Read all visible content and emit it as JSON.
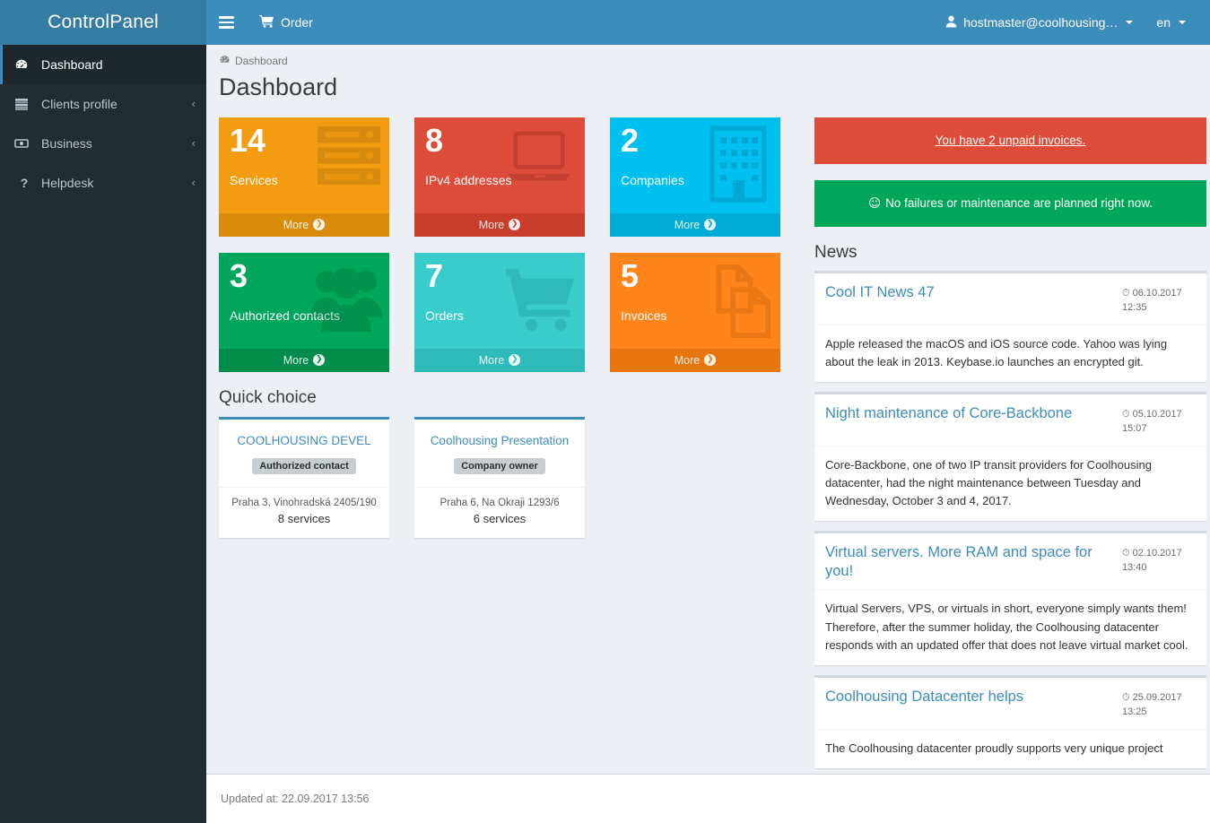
{
  "brand": {
    "name": "ControlPanel"
  },
  "header": {
    "menu_toggle": "menu-toggle",
    "order_label": "Order",
    "user_label": "hostmaster@coolhousing…",
    "lang_label": "en"
  },
  "sidebar": {
    "items": [
      {
        "label": "Dashboard",
        "icon": "dashboard-icon",
        "active": true,
        "caret": ""
      },
      {
        "label": "Clients profile",
        "icon": "server-icon",
        "active": false,
        "caret": "‹"
      },
      {
        "label": "Business",
        "icon": "money-icon",
        "active": false,
        "caret": "‹"
      },
      {
        "label": "Helpdesk",
        "icon": "question-icon",
        "active": false,
        "caret": "‹"
      }
    ]
  },
  "breadcrumb": {
    "icon": "dashboard-icon",
    "label": "Dashboard"
  },
  "page": {
    "title": "Dashboard"
  },
  "tiles": [
    {
      "number": "14",
      "caption": "Services",
      "more": "More",
      "color": "#f39c12",
      "footer_color": "#db8b0b",
      "icon": "server-rack-icon"
    },
    {
      "number": "8",
      "caption": "IPv4 addresses",
      "more": "More",
      "color": "#dd4b39",
      "footer_color": "#c93d2b",
      "icon": "laptop-icon"
    },
    {
      "number": "2",
      "caption": "Companies",
      "more": "More",
      "color": "#00c0ef",
      "footer_color": "#00acd6",
      "icon": "building-icon"
    },
    {
      "number": "3",
      "caption": "Authorized contacts",
      "more": "More",
      "color": "#00a65a",
      "footer_color": "#008d4c",
      "icon": "users-icon"
    },
    {
      "number": "7",
      "caption": "Orders",
      "more": "More",
      "color": "#39cccc",
      "footer_color": "#30bbbb",
      "icon": "cart-icon"
    },
    {
      "number": "5",
      "caption": "Invoices",
      "more": "More",
      "color": "#ff851b",
      "footer_color": "#e8760f",
      "icon": "files-icon"
    }
  ],
  "quick_choice": {
    "title": "Quick choice",
    "cards": [
      {
        "name": "COOLHOUSING DEVEL",
        "badge": "Authorized contact",
        "address": "Praha 3, Vinohradská 2405/190",
        "services": "8 services"
      },
      {
        "name": "Coolhousing Presentation",
        "badge": "Company owner",
        "address": "Praha 6, Na Okraji 1293/6",
        "services": "6 services"
      }
    ]
  },
  "alerts": [
    {
      "type": "danger",
      "text": "You have 2 unpaid invoices.",
      "link": true,
      "icon": ""
    },
    {
      "type": "success",
      "text": "No failures or maintenance are planned right now.",
      "link": false,
      "icon": "☺"
    }
  ],
  "news": {
    "title": "News",
    "items": [
      {
        "title": "Cool IT News 47",
        "date": "06.10.2017",
        "time": "12:35",
        "body": "Apple released the macOS and iOS source code. Yahoo was lying about the leak in 2013. Keybase.io launches an encrypted git."
      },
      {
        "title": "Night maintenance of Core-Backbone",
        "date": "05.10.2017",
        "time": "15:07",
        "body": "Core-Backbone, one of two IP transit providers for Coolhousing datacenter, had the night maintenance between Tuesday and Wednesday, October 3 and 4, 2017."
      },
      {
        "title": "Virtual servers. More RAM and space for you!",
        "date": "02.10.2017",
        "time": "13:40",
        "body": "Virtual Servers, VPS, or virtuals in short, everyone simply wants them! Therefore, after the summer holiday, the Coolhousing datacenter responds with an updated offer that does not leave virtual market cool."
      },
      {
        "title": "Coolhousing Datacenter helps",
        "date": "25.09.2017",
        "time": "13:25",
        "body": "The Coolhousing datacenter proudly supports very unique project"
      }
    ]
  },
  "footer": {
    "updated": "Updated at: 22.09.2017 13:56"
  },
  "colors": {
    "brand_blue": "#3c8dbc",
    "logo_blue": "#357ca5",
    "sidebar_dark": "#222d32",
    "content_bg": "#ecf0f5",
    "danger": "#dd4b39",
    "success": "#00a65a"
  }
}
